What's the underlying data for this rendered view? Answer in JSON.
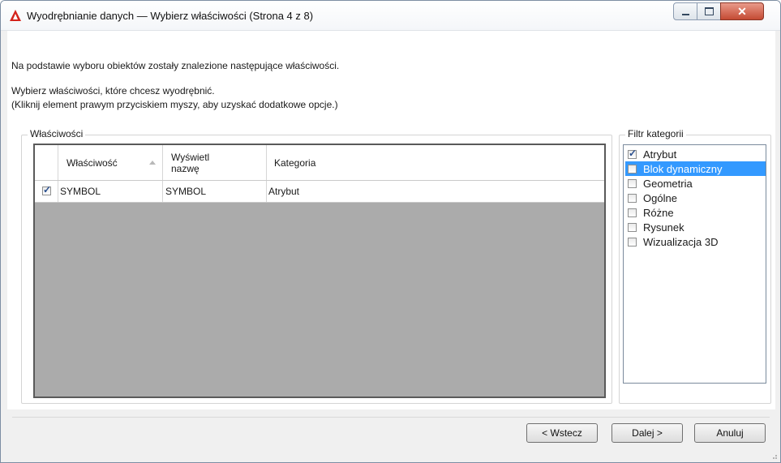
{
  "window": {
    "title": "Wyodrębnianie danych — Wybierz właściwości (Strona 4 z 8)",
    "icons": {
      "app": "autocad-logo-icon",
      "minimize": "minimize-icon",
      "maximize": "maximize-icon",
      "close": "close-icon"
    }
  },
  "description": {
    "line1": "Na podstawie wyboru obiektów zostały znalezione następujące właściwości.",
    "line2": "Wybierz właściwości, które chcesz wyodrębnić.",
    "line3": "(Kliknij element prawym przyciskiem myszy, aby uzyskać dodatkowe opcje.)"
  },
  "properties_group": {
    "label": "Właściwości",
    "columns": [
      "Właściwość",
      "Wyświetl nazwę",
      "Kategoria"
    ],
    "column_header_display_line1": "Wyświetl",
    "column_header_display_line2": "nazwę",
    "sort_column": "Właściwość",
    "rows": [
      {
        "checked": true,
        "property": "SYMBOL",
        "display_name": "SYMBOL",
        "category": "Atrybut"
      }
    ]
  },
  "filter_group": {
    "label": "Filtr kategorii",
    "items": [
      {
        "label": "Atrybut",
        "checked": true,
        "selected": false
      },
      {
        "label": "Blok dynamiczny",
        "checked": false,
        "selected": true
      },
      {
        "label": "Geometria",
        "checked": false,
        "selected": false
      },
      {
        "label": "Ogólne",
        "checked": false,
        "selected": false
      },
      {
        "label": "Różne",
        "checked": false,
        "selected": false
      },
      {
        "label": "Rysunek",
        "checked": false,
        "selected": false
      },
      {
        "label": "Wizualizacja 3D",
        "checked": false,
        "selected": false
      }
    ]
  },
  "buttons": {
    "back": "< Wstecz",
    "next": "Dalej >",
    "cancel": "Anuluj"
  },
  "colors": {
    "selection": "#3399ff",
    "grid_empty": "#ababab",
    "close_button": "#c44a33"
  }
}
